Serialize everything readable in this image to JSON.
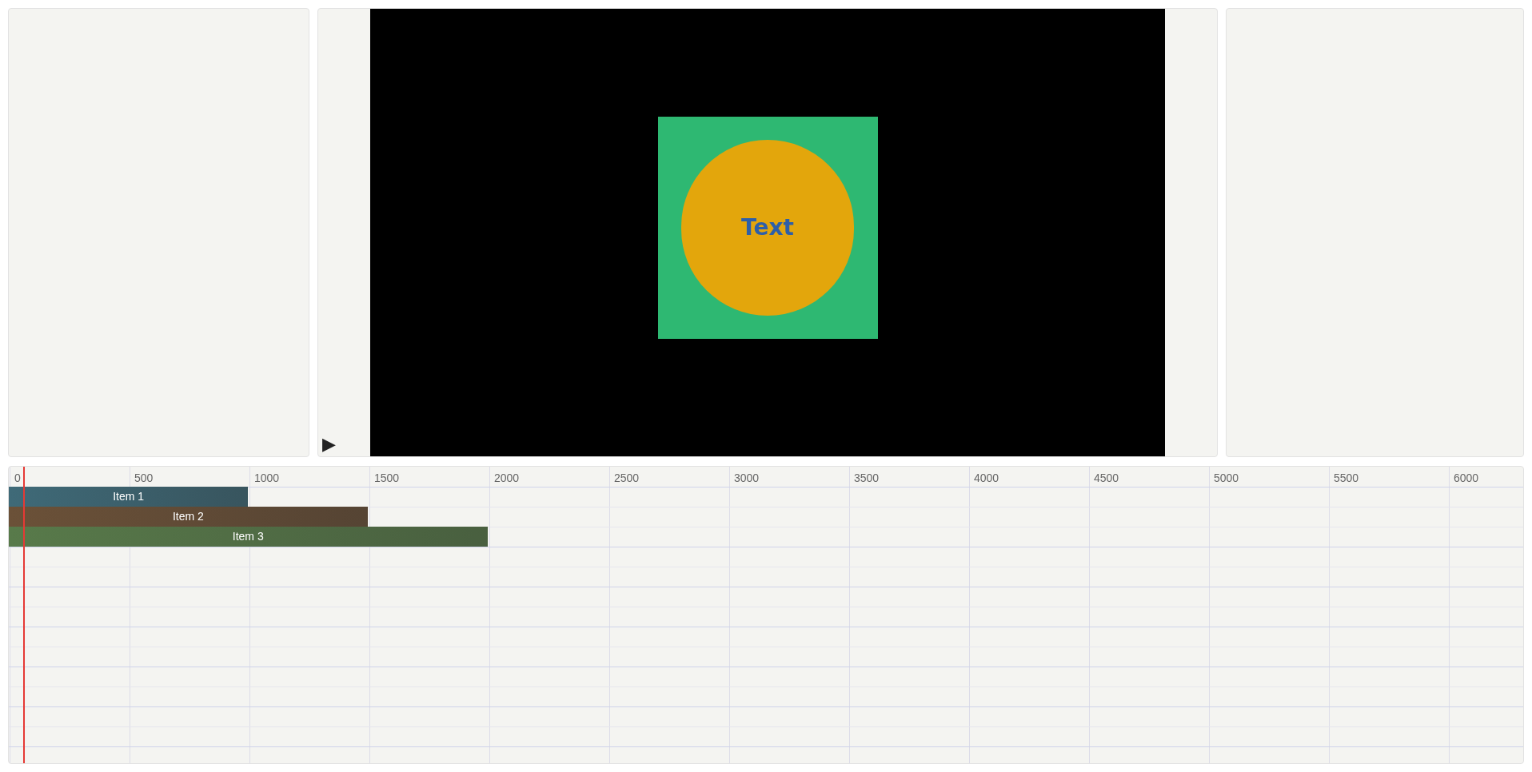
{
  "preview": {
    "play_button": {
      "label": "▶"
    },
    "stage": {
      "shapes": [
        {
          "kind": "square",
          "color": "#2eb872"
        },
        {
          "kind": "circle",
          "color": "#e3a60c",
          "text": "Text"
        }
      ]
    }
  },
  "timeline": {
    "ruler": [
      "0",
      "500",
      "1000",
      "1500",
      "2000",
      "2500",
      "3000",
      "3500",
      "4000",
      "4500",
      "5000",
      "5500",
      "6000"
    ],
    "playhead": {
      "level": 0.0095
    },
    "items": [
      {
        "label": "Item 1",
        "color": "#3f6a78",
        "level": 0.158
      },
      {
        "label": "Item 2",
        "color": "#6b5138",
        "level": 0.237
      },
      {
        "label": "Item 3",
        "color": "#587a4a",
        "level": 0.316
      }
    ]
  }
}
